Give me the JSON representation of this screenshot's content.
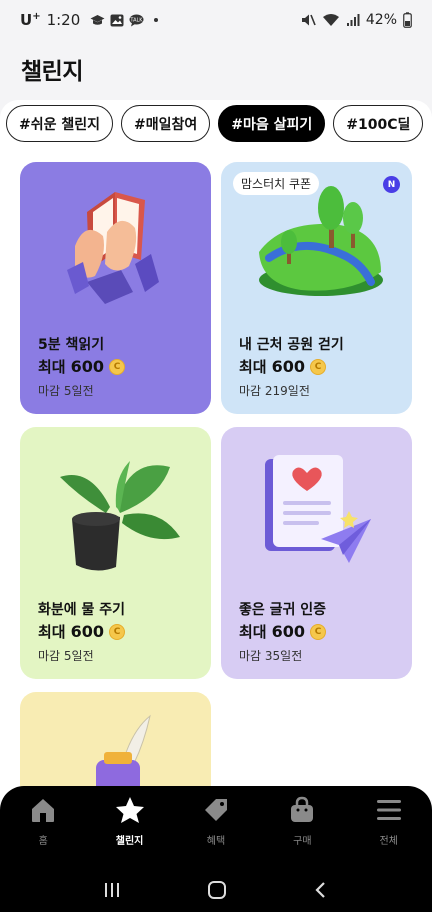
{
  "status_bar": {
    "carrier": "U",
    "carrier_sup": "+",
    "time": "1:20",
    "battery": "42%"
  },
  "page": {
    "title": "챌린지"
  },
  "chips": [
    {
      "label": "#쉬운 챌린지",
      "active": false
    },
    {
      "label": "#매일참여",
      "active": false
    },
    {
      "label": "#마음 살피기",
      "active": true
    },
    {
      "label": "#100C딜",
      "active": false
    }
  ],
  "cards": [
    {
      "name": "5분 책읽기",
      "reward_prefix": "최대",
      "reward": "600",
      "deadline": "마감 5일전",
      "bg": "#8b7ce3",
      "icon": "book-hands-icon"
    },
    {
      "name": "내 근처 공원 걷기",
      "reward_prefix": "최대",
      "reward": "600",
      "deadline": "마감 219일전",
      "bg": "#cfe4f7",
      "tag": "맘스터치 쿠폰",
      "badge": "N",
      "icon": "park-island-icon"
    },
    {
      "name": "화분에 물 주기",
      "reward_prefix": "최대",
      "reward": "600",
      "deadline": "마감 5일전",
      "bg": "#e3f5c3",
      "icon": "potted-plant-icon"
    },
    {
      "name": "좋은 글귀 인증",
      "reward_prefix": "최대",
      "reward": "600",
      "deadline": "마감 35일전",
      "bg": "#d7ccf3",
      "icon": "letter-plane-icon"
    },
    {
      "name": "",
      "bg": "#f8ecb3",
      "icon": "ink-quill-icon"
    }
  ],
  "coin_symbol": "C",
  "bottom_nav": [
    {
      "label": "홈",
      "icon": "home-icon",
      "active": false
    },
    {
      "label": "챌린지",
      "icon": "star-icon",
      "active": true
    },
    {
      "label": "혜택",
      "icon": "tag-icon",
      "active": false
    },
    {
      "label": "구매",
      "icon": "shopping-bag-icon",
      "active": false
    },
    {
      "label": "전체",
      "icon": "menu-icon",
      "active": false
    }
  ]
}
